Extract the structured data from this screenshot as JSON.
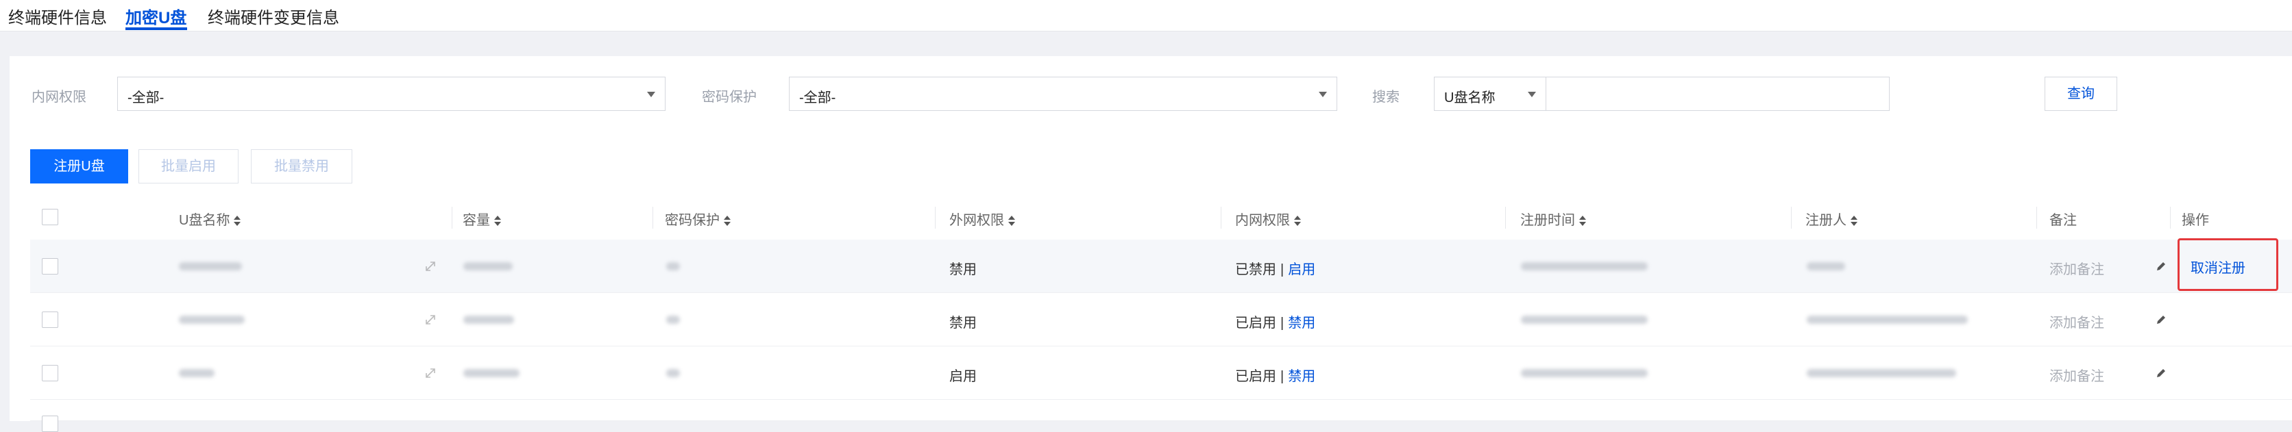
{
  "tabs": [
    {
      "label": "终端硬件信息",
      "active": false
    },
    {
      "label": "加密U盘",
      "active": true
    },
    {
      "label": "终端硬件变更信息",
      "active": false
    }
  ],
  "filters": {
    "intranet_label": "内网权限",
    "intranet_value": "-全部-",
    "password_label": "密码保护",
    "password_value": "-全部-",
    "search_label": "搜索",
    "search_field": "U盘名称",
    "search_value": "",
    "query_button": "查询"
  },
  "actions": {
    "register": "注册U盘",
    "batch_enable": "批量启用",
    "batch_disable": "批量禁用"
  },
  "table": {
    "columns": [
      "U盘名称",
      "容量",
      "密码保护",
      "外网权限",
      "内网权限",
      "注册时间",
      "注册人",
      "备注",
      "操作"
    ],
    "rows": [
      {
        "extranet": "禁用",
        "intranet_status": "已禁用",
        "intranet_action": "启用",
        "note": "添加备注",
        "operation": "取消注册"
      },
      {
        "extranet": "禁用",
        "intranet_status": "已启用",
        "intranet_action": "禁用",
        "note": "添加备注",
        "operation": ""
      },
      {
        "extranet": "启用",
        "intranet_status": "已启用",
        "intranet_action": "禁用",
        "note": "添加备注",
        "operation": ""
      }
    ]
  },
  "colors": {
    "accent": "#0052d9",
    "primary_button": "#0a6cff",
    "highlight_box": "#e4393c"
  },
  "icons": [
    "chevron-down-icon",
    "sort-icon",
    "edit-icon",
    "expand-icon"
  ]
}
